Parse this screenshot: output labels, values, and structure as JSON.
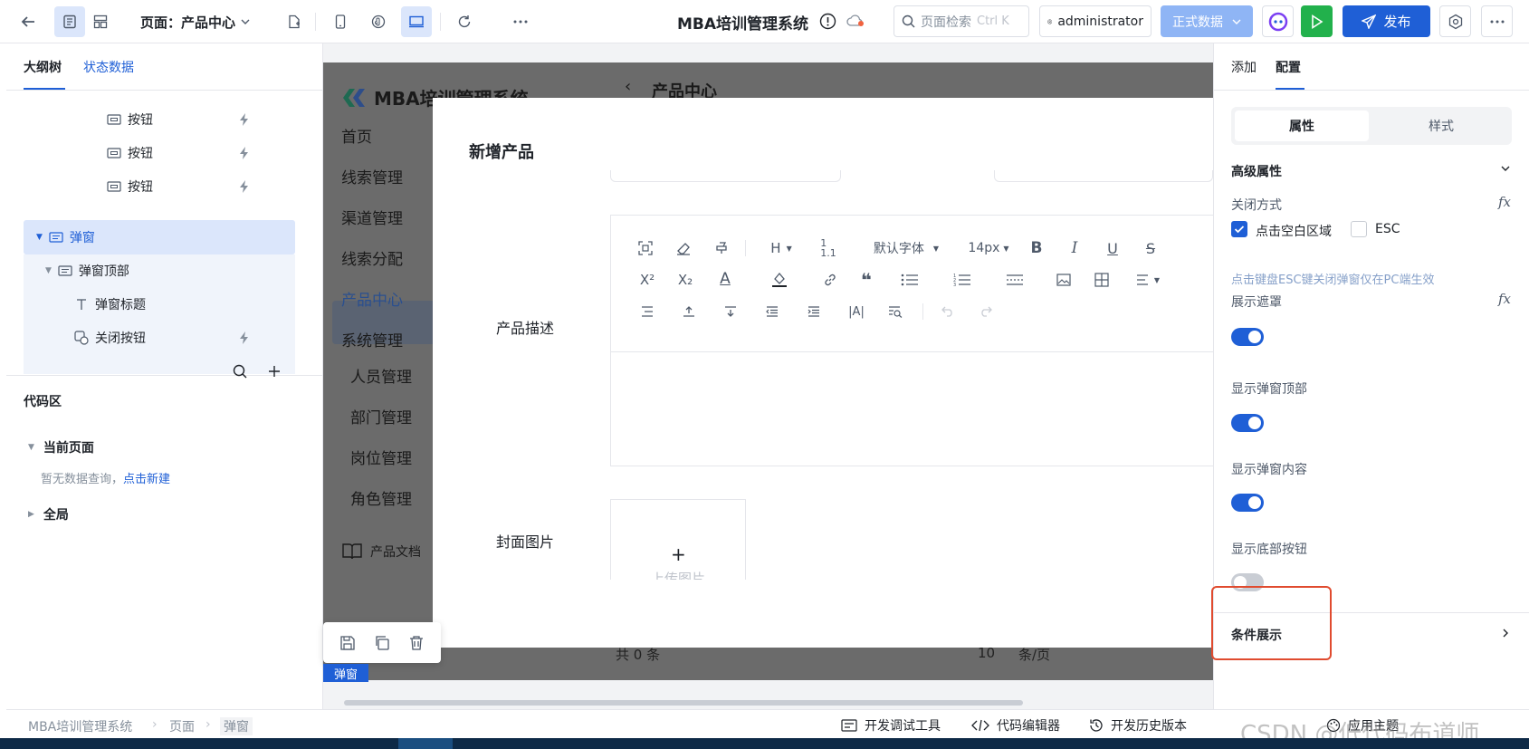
{
  "topbar": {
    "page_label": "页面：产品中心",
    "app_title": "MBA培训管理系统",
    "search_placeholder": "页面检索",
    "search_shortcut": "Ctrl K",
    "user": "administrator",
    "env": "正式数据",
    "publish": "发布"
  },
  "left": {
    "tabs": [
      "大纲树",
      "状态数据"
    ],
    "tree": [
      {
        "label": "按钮"
      },
      {
        "label": "按钮"
      },
      {
        "label": "按钮"
      },
      {
        "label": "弹窗"
      },
      {
        "label": "弹窗顶部"
      },
      {
        "label": "弹窗标题"
      },
      {
        "label": "关闭按钮"
      }
    ],
    "code_title": "代码区",
    "code_current": "当前页面",
    "code_empty": "暂无数据查询，",
    "code_empty_link": "点击新建",
    "code_global": "全局"
  },
  "preview": {
    "logo": "MBA培训管理系统",
    "page_header": "产品中心",
    "menu": [
      "首页",
      "线索管理",
      "渠道管理",
      "线索分配",
      "产品中心",
      "系统管理"
    ],
    "submenu": [
      "人员管理",
      "部门管理",
      "岗位管理",
      "角色管理"
    ],
    "docs": "产品文档",
    "pager_text": "共 0 条",
    "pager_size": "10",
    "pager_unit": "条/页"
  },
  "dialog": {
    "title": "新增产品",
    "field_desc": "产品描述",
    "field_cover": "封面图片",
    "font_default": "默认字体",
    "font_size": "14px",
    "upload_plus": "+",
    "upload_label": "上传图片"
  },
  "canvas_tag": "弹窗",
  "right": {
    "tabs": [
      "添加",
      "配置"
    ],
    "seg": [
      "属性",
      "样式"
    ],
    "section_advanced": "高级属性",
    "close_method": "关闭方式",
    "opt_click_blank": "点击空白区域",
    "opt_esc": "ESC",
    "hint": "点击键盘ESC键关闭弹窗仅在PC端生效",
    "mask": "展示遮罩",
    "show_header": "显示弹窗顶部",
    "show_content": "显示弹窗内容",
    "show_footer": "显示底部按钮",
    "cond": "条件展示",
    "toggles": {
      "mask": true,
      "header": true,
      "content": true,
      "footer": false
    }
  },
  "statusbar": {
    "crumbs": [
      "MBA培训管理系统",
      "页面",
      "弹窗"
    ],
    "debug": "开发调试工具",
    "code_editor": "代码编辑器",
    "history": "开发历史版本",
    "theme": "应用主题",
    "watermark": "CSDN @低代码布道师"
  }
}
